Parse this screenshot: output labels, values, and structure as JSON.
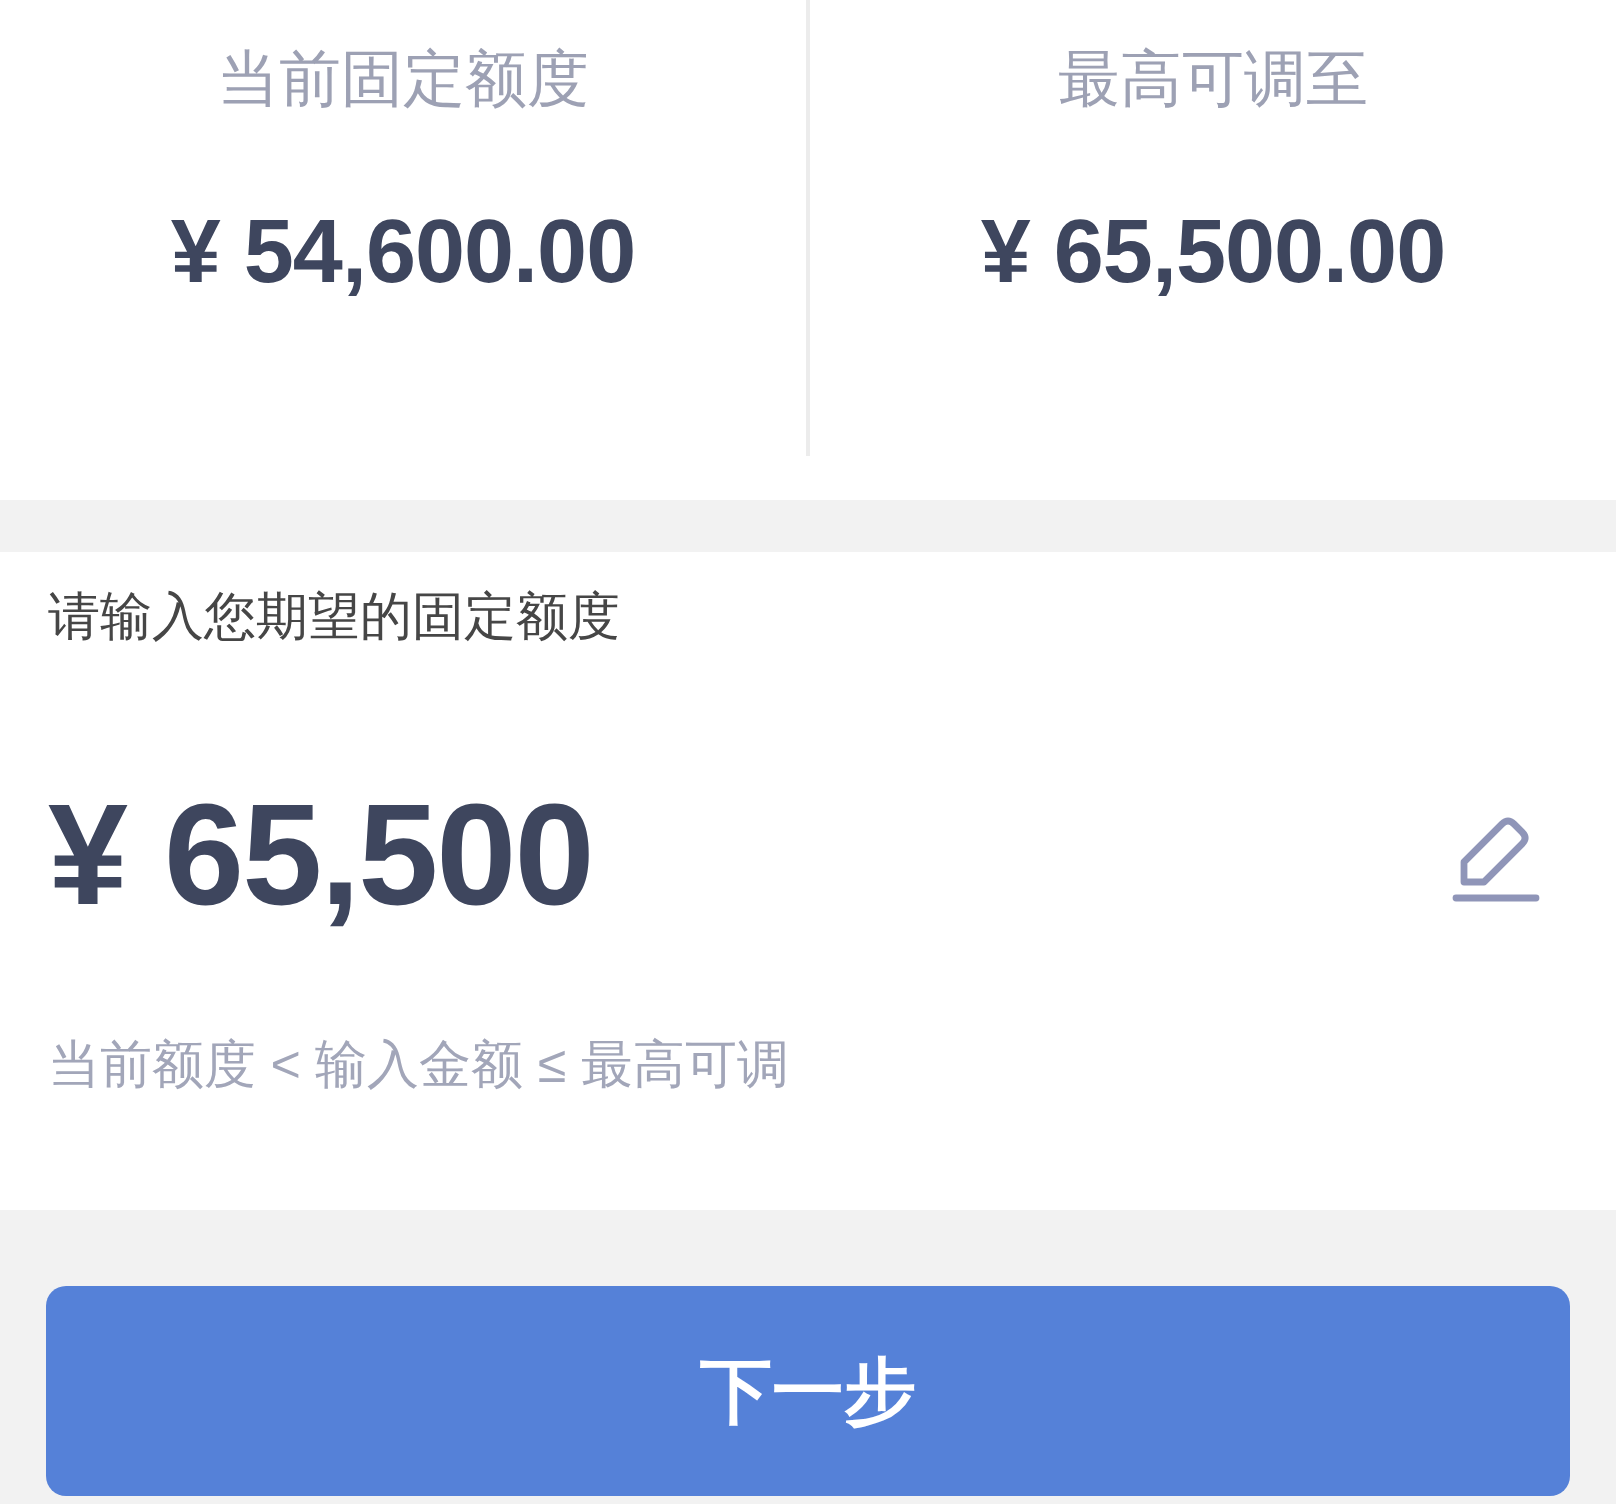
{
  "limits": [
    {
      "label": "当前固定额度",
      "amount": "¥ 54,600.00"
    },
    {
      "label": "最高可调至",
      "amount": "¥ 65,500.00"
    }
  ],
  "amount_input": {
    "label": "请输入您期望的固定额度",
    "value": "¥ 65,500",
    "hint": "当前额度 < 输入金额 ≤ 最高可调"
  },
  "next_button": {
    "label": "下一步",
    "disabled": false
  }
}
